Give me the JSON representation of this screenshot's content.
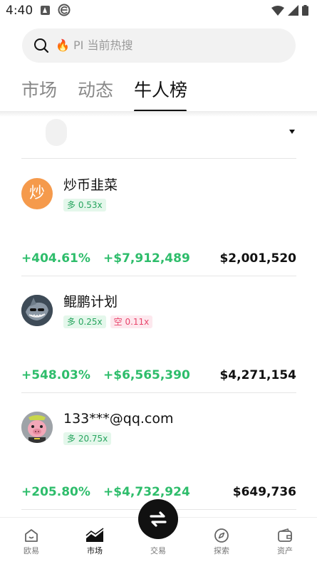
{
  "status_bar": {
    "time": "4:40"
  },
  "search": {
    "fire_icon": "🔥",
    "placeholder": "PI 当前热搜"
  },
  "tabs": [
    {
      "label": "市场",
      "active": false
    },
    {
      "label": "动态",
      "active": false
    },
    {
      "label": "牛人榜",
      "active": true
    }
  ],
  "traders": [
    {
      "name": "炒币韭菜",
      "avatar_text": "炒",
      "avatar_color": "#f59a4c",
      "badges": [
        {
          "type": "long",
          "label": "多 0.53x"
        }
      ],
      "roi": "+404.61%",
      "pnl": "+$7,912,489",
      "aum": "$2,001,520"
    },
    {
      "name": "鲲鹏计划",
      "avatar_text": "",
      "avatar_color": "#2f3a45",
      "badges": [
        {
          "type": "long",
          "label": "多 0.25x"
        },
        {
          "type": "short",
          "label": "空 0.11x"
        }
      ],
      "roi": "+548.03%",
      "pnl": "+$6,565,390",
      "aum": "$4,271,154"
    },
    {
      "name": "133***@qq.com",
      "avatar_text": "",
      "avatar_color": "#b9b9b9",
      "badges": [
        {
          "type": "long",
          "label": "多 20.75x"
        }
      ],
      "roi": "+205.80%",
      "pnl": "+$4,732,924",
      "aum": "$649,736"
    }
  ],
  "bottom_nav": [
    {
      "label": "欧易",
      "icon": "home-icon"
    },
    {
      "label": "市场",
      "icon": "market-chart-icon",
      "active": true
    },
    {
      "label": "交易",
      "icon": "swap-icon"
    },
    {
      "label": "探索",
      "icon": "compass-icon"
    },
    {
      "label": "资产",
      "icon": "wallet-icon"
    }
  ],
  "colors": {
    "positive": "#2ebd6b",
    "negative": "#e8456b",
    "primary": "#111111"
  }
}
